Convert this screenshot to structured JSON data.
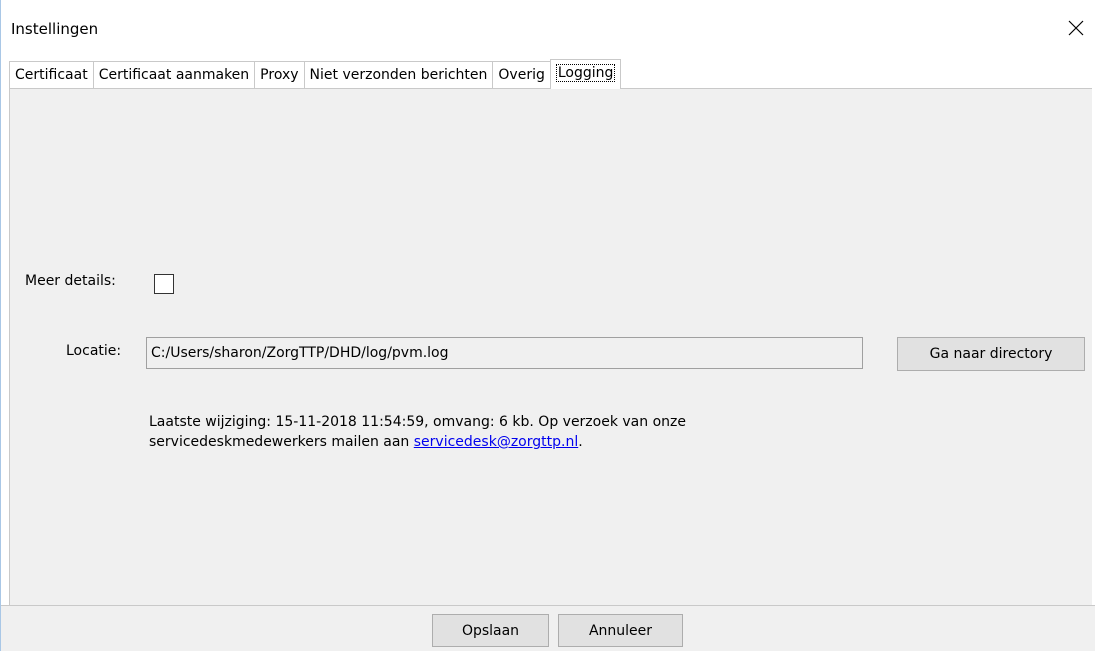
{
  "window": {
    "title": "Instellingen"
  },
  "tabs": [
    {
      "label": "Certificaat"
    },
    {
      "label": "Certificaat aanmaken"
    },
    {
      "label": "Proxy"
    },
    {
      "label": "Niet verzonden berichten"
    },
    {
      "label": "Overig"
    },
    {
      "label": "Logging"
    }
  ],
  "active_tab": "Logging",
  "logging": {
    "details_label": "Meer details:",
    "details_checked": false,
    "location_label": "Locatie:",
    "location_value": "C:/Users/sharon/ZorgTTP/DHD/log/pvm.log",
    "goto_directory_label": "Ga naar directory",
    "info_line1": "Laatste wijziging: 15-11-2018 11:54:59, omvang: 6 kb. Op verzoek van onze",
    "info_line2_prefix": "servicedeskmedewerkers mailen aan ",
    "info_email": "servicedesk@zorgttp.nl",
    "info_line2_suffix": "."
  },
  "footer": {
    "save_label": "Opslaan",
    "cancel_label": "Annuleer"
  },
  "icons": {
    "close": "close-icon"
  }
}
